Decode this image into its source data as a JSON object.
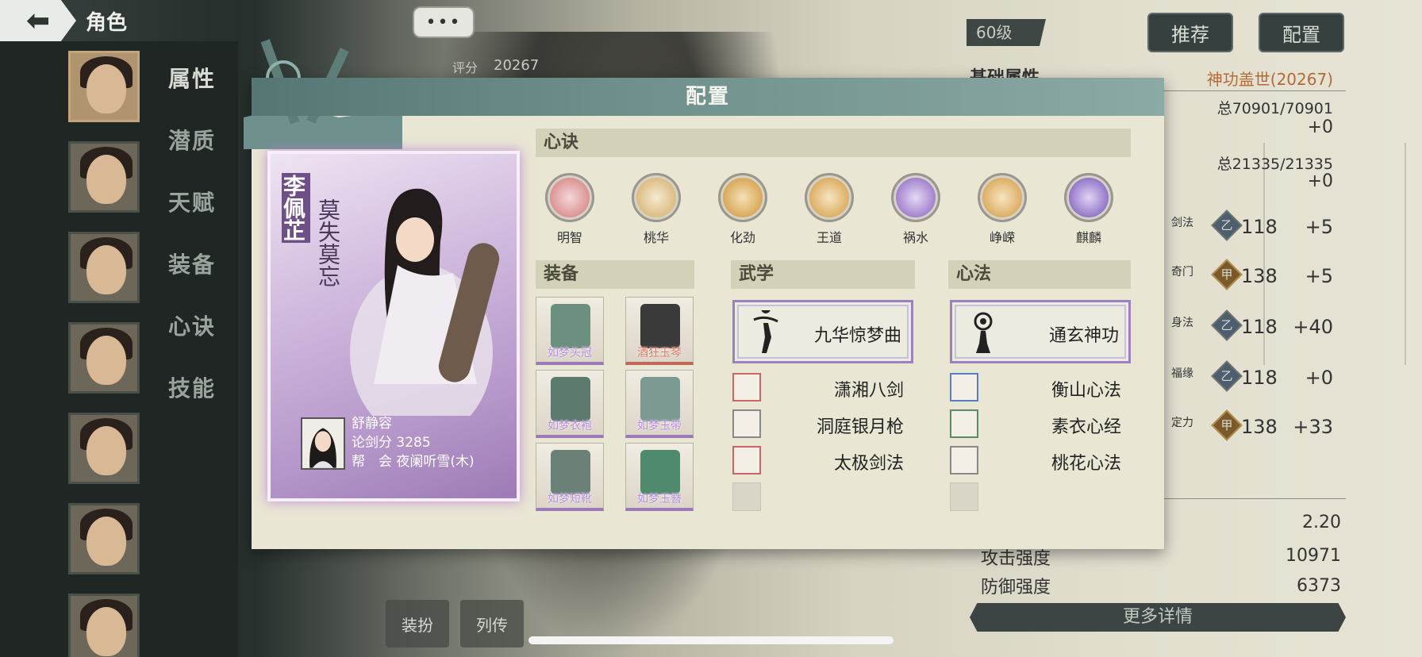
{
  "header": {
    "title": "角色",
    "back_glyph": "⬅"
  },
  "top": {
    "chat_glyph": "•••",
    "score_label": "评分",
    "score_value": "20267"
  },
  "sidebar": {
    "tabs": [
      "属性",
      "潜质",
      "天赋",
      "装备",
      "心诀",
      "技能"
    ],
    "active_tab": 0
  },
  "right_panel": {
    "level": "60级",
    "recommend_btn": "推荐",
    "config_btn": "配置",
    "base_attr_title": "基础属性",
    "power_title": "神功盖世(20267)",
    "total1": "总70901/70901",
    "plus1": "+0",
    "total2": "总21335/21335",
    "plus2": "+0",
    "attrs": [
      {
        "label": "剑法",
        "value": "118",
        "bonus": "+5",
        "icon": "乙",
        "tier": "blue"
      },
      {
        "label": "奇门",
        "value": "138",
        "bonus": "+5",
        "icon": "甲",
        "tier": "gold"
      },
      {
        "label": "身法",
        "value": "118",
        "bonus": "+40",
        "icon": "乙",
        "tier": "blue"
      },
      {
        "label": "福缘",
        "value": "118",
        "bonus": "+0",
        "icon": "乙",
        "tier": "blue"
      },
      {
        "label": "定力",
        "value": "138",
        "bonus": "+33",
        "icon": "甲",
        "tier": "gold"
      }
    ],
    "crit_value": "2.20",
    "attack_label": "攻击强度",
    "attack_value": "10971",
    "defense_label": "防御强度",
    "defense_value": "6373",
    "more_btn": "更多详情"
  },
  "bottom_tabs": [
    "装扮",
    "列传"
  ],
  "modal": {
    "title": "配置",
    "character": {
      "name": "李佩芷",
      "title": "莫失莫忘",
      "player_name": "舒静容",
      "sword_score": "论剑分 3285",
      "guild": "帮　会 夜阑听雪(木)"
    },
    "xinjue_header": "心诀",
    "xinjue": [
      {
        "name": "明智",
        "color": "#d98b8b",
        "icon": "heart-lotus-icon"
      },
      {
        "name": "桃华",
        "color": "#d9b77a",
        "icon": "flower-figure-icon"
      },
      {
        "name": "化劲",
        "color": "#d6a24f",
        "icon": "swirl-energy-icon"
      },
      {
        "name": "王道",
        "color": "#d9a85a",
        "icon": "dragon-icon"
      },
      {
        "name": "祸水",
        "color": "#9a79c9",
        "icon": "woman-figure-icon"
      },
      {
        "name": "峥嵘",
        "color": "#d9a85a",
        "icon": "beast-icon"
      },
      {
        "name": "麒麟",
        "color": "#8a6cc4",
        "icon": "qilin-icon"
      }
    ],
    "equip_header": "装备",
    "equipment": [
      {
        "name": "如梦头冠",
        "color": "#6b8f7e",
        "tier": "purple"
      },
      {
        "name": "酒狂玉琴",
        "color": "#3a3a3a",
        "tier": "red"
      },
      {
        "name": "如梦衣袍",
        "color": "#5c7a6e",
        "tier": "purple"
      },
      {
        "name": "如梦玉带",
        "color": "#7c9a92",
        "tier": "purple"
      },
      {
        "name": "如梦短靴",
        "color": "#6b8076",
        "tier": "purple"
      },
      {
        "name": "如梦玉簪",
        "color": "#4f8a6e",
        "tier": "purple"
      }
    ],
    "wuxue_header": "武学",
    "wuxue_main": "九华惊梦曲",
    "wuxue_list": [
      {
        "name": "潇湘八剑",
        "tier": "red"
      },
      {
        "name": "洞庭银月枪",
        "tier": "gray"
      },
      {
        "name": "太极剑法",
        "tier": "red"
      }
    ],
    "xinfa_header": "心法",
    "xinfa_main": "通玄神功",
    "xinfa_list": [
      {
        "name": "衡山心法",
        "tier": "blue"
      },
      {
        "name": "素衣心经",
        "tier": "green"
      },
      {
        "name": "桃花心法",
        "tier": "gray"
      }
    ]
  }
}
